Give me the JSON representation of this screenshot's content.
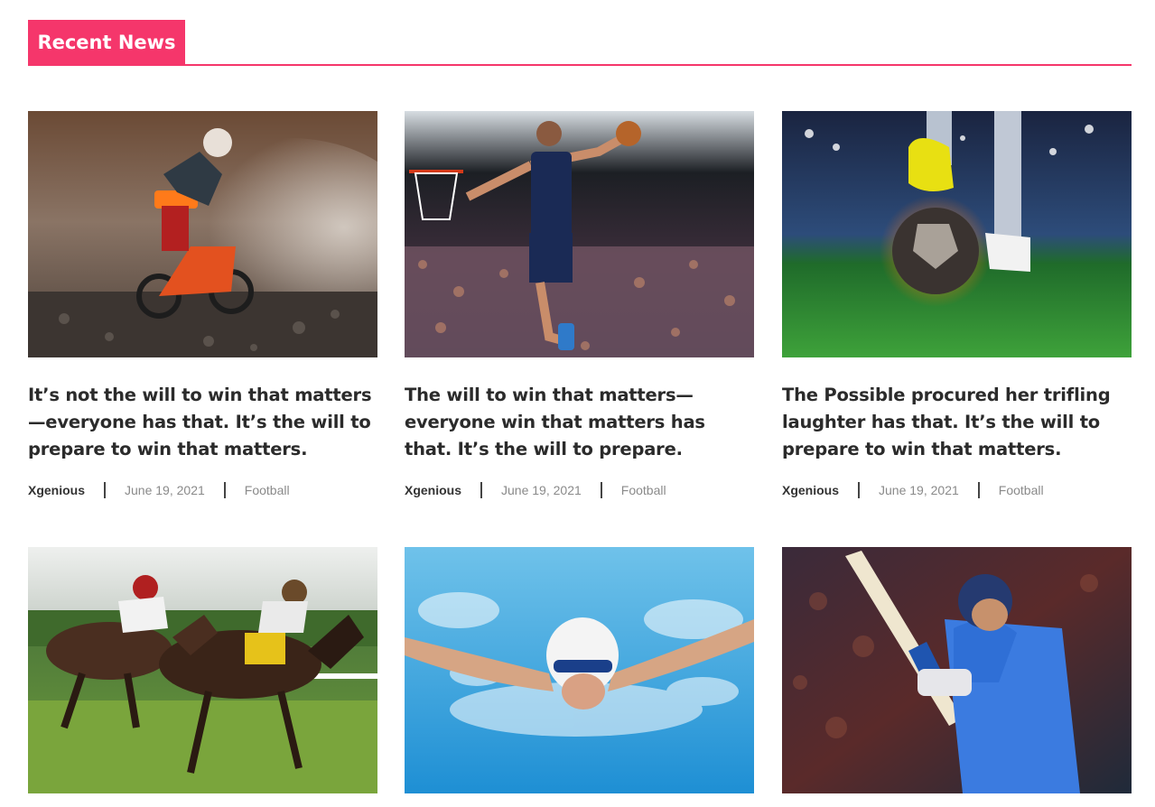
{
  "section": {
    "title": "Recent News",
    "accent": "#f5366b"
  },
  "posts": [
    {
      "title": "It’s not the will to win that matters—everyone has that. It’s the will to prepare to win that matters.",
      "author": "Xgenious",
      "date": "June 19, 2021",
      "category": "Football",
      "image": "motocross-photo"
    },
    {
      "title": "The will to win that matters—everyone win that matters has that. It’s the will to prepare.",
      "author": "Xgenious",
      "date": "June 19, 2021",
      "category": "Football",
      "image": "basketball-photo"
    },
    {
      "title": "The Possible procured her trifling laughter has that. It’s the will to prepare to win that matters.",
      "author": "Xgenious",
      "date": "June 19, 2021",
      "category": "Football",
      "image": "soccer-photo"
    },
    {
      "title": "",
      "author": "",
      "date": "",
      "category": "",
      "image": "horse-racing-photo"
    },
    {
      "title": "",
      "author": "",
      "date": "",
      "category": "",
      "image": "swimming-photo"
    },
    {
      "title": "",
      "author": "",
      "date": "",
      "category": "",
      "image": "cricket-photo"
    }
  ]
}
